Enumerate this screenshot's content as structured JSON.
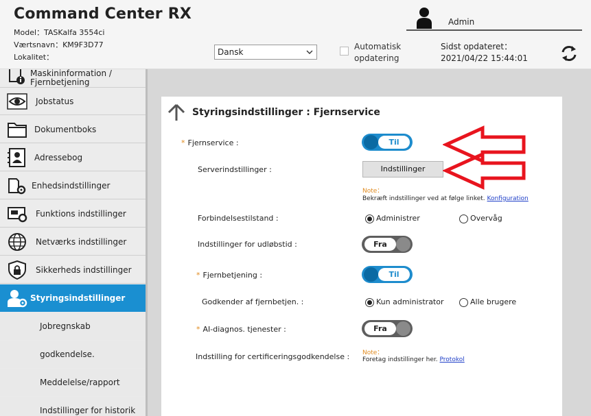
{
  "header": {
    "app_title": "Command Center RX",
    "model": "Model：TASKalfa 3554ci",
    "hostname": "Værtsnavn：KM9F3D77",
    "location": "Lokalitet："
  },
  "user": {
    "name": "Admin"
  },
  "toolbar": {
    "language": "Dansk",
    "auto_update_label": "Automatisk opdatering",
    "last_updated_label": "Sidst opdateret：",
    "last_updated_value": "2021/04/22 15:44:01"
  },
  "sidebar": {
    "items": [
      {
        "label": "Maskininformation / Fjernbetjening"
      },
      {
        "label": "Jobstatus"
      },
      {
        "label": "Dokumentboks"
      },
      {
        "label": "Adressebog"
      },
      {
        "label": "Enhedsindstillinger"
      },
      {
        "label": "Funktions indstillinger"
      },
      {
        "label": "Netværks indstillinger"
      },
      {
        "label": "Sikkerheds indstillinger"
      },
      {
        "label": "Styringsindstillinger"
      }
    ],
    "subitems": [
      {
        "label": "Jobregnskab"
      },
      {
        "label": "godkendelse."
      },
      {
        "label": "Meddelelse/rapport"
      },
      {
        "label": "Indstillinger for historik"
      }
    ]
  },
  "page": {
    "title": "Styringsindstillinger : Fjernservice"
  },
  "form": {
    "remote_service": {
      "required_mark": "*",
      "label": "Fjernservice :",
      "value": "Til"
    },
    "server_settings": {
      "label": "Serverindstillinger :",
      "button": "Indstillinger"
    },
    "note1": {
      "title": "Note：",
      "text": "Bekræft indstillinger ved at følge linket.",
      "link": "Konfiguration"
    },
    "connection_state": {
      "label": "Forbindelsestilstand :",
      "options": [
        "Administrer",
        "Overvåg"
      ],
      "selected": "Administrer"
    },
    "expiry_settings": {
      "label": "Indstillinger for udløbstid :",
      "value": "Fra"
    },
    "remote_operation": {
      "required_mark": "*",
      "label": "Fjernbetjening :",
      "value": "Til"
    },
    "remote_approver": {
      "label": "Godkender af fjernbetjen. :",
      "options": [
        "Kun administrator",
        "Alle brugere"
      ],
      "selected": "Kun administrator"
    },
    "ai_diag": {
      "required_mark": "*",
      "label": "AI-diagnos. tjenester :",
      "value": "Fra"
    },
    "cert_approval": {
      "label": "Indstilling for certificeringsgodkendelse :"
    },
    "note2": {
      "title": "Note：",
      "text": "Foretag indstillinger her.",
      "link": "Protokol"
    }
  },
  "colors": {
    "accent": "#1a8fd1",
    "toggle_on": "#1d8ccd",
    "required": "#e08a1e",
    "arrow": "#e8141e"
  },
  "icons": [
    "user-icon",
    "chevron-down-icon",
    "refresh-icon",
    "back-arrow-icon",
    "red-arrow-icon"
  ]
}
